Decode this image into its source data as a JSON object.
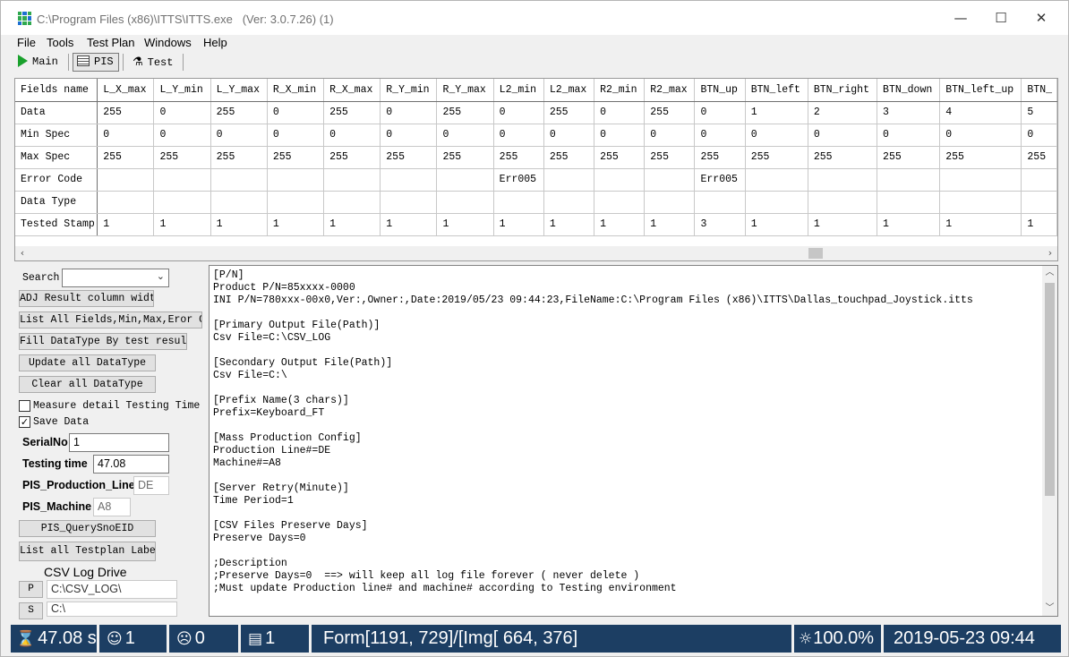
{
  "window": {
    "title": "C:\\Program Files (x86)\\ITTS\\ITTS.exe",
    "version": "(Ver: 3.0.7.26) (1)",
    "minimize": "—",
    "maximize": "☐",
    "close": "✕"
  },
  "menu": [
    "File",
    "Tools",
    "Test Plan",
    "Windows",
    "Help"
  ],
  "toolbar": {
    "main": "Main",
    "pis": "PIS",
    "test": "Test"
  },
  "grid": {
    "columns": [
      "Fields name",
      "L_X_max",
      "L_Y_min",
      "L_Y_max",
      "R_X_min",
      "R_X_max",
      "R_Y_min",
      "R_Y_max",
      "L2_min",
      "L2_max",
      "R2_min",
      "R2_max",
      "BTN_up",
      "BTN_left",
      "BTN_right",
      "BTN_down",
      "BTN_left_up",
      "BTN_"
    ],
    "rows": [
      [
        "Data",
        "255",
        "0",
        "255",
        "0",
        "255",
        "0",
        "255",
        "0",
        "255",
        "0",
        "255",
        "0",
        "1",
        "2",
        "3",
        "4",
        "5"
      ],
      [
        "Min Spec",
        "0",
        "0",
        "0",
        "0",
        "0",
        "0",
        "0",
        "0",
        "0",
        "0",
        "0",
        "0",
        "0",
        "0",
        "0",
        "0",
        "0"
      ],
      [
        "Max Spec",
        "255",
        "255",
        "255",
        "255",
        "255",
        "255",
        "255",
        "255",
        "255",
        "255",
        "255",
        "255",
        "255",
        "255",
        "255",
        "255",
        "255"
      ],
      [
        "Error Code",
        "",
        "",
        "",
        "",
        "",
        "",
        "",
        "Err005",
        "",
        "",
        "",
        "Err005",
        "",
        "",
        "",
        "",
        ""
      ],
      [
        "Data Type",
        "",
        "",
        "",
        "",
        "",
        "",
        "",
        "",
        "",
        "",
        "",
        "",
        "",
        "",
        "",
        "",
        ""
      ],
      [
        "Tested Stamp",
        "1",
        "1",
        "1",
        "1",
        "1",
        "1",
        "1",
        "1",
        "1",
        "1",
        "1",
        "3",
        "1",
        "1",
        "1",
        "1",
        "1"
      ]
    ]
  },
  "left": {
    "search_label": "Search",
    "search_value": "",
    "btn_adj": "ADJ Result column width",
    "btn_list_fields": "List All Fields,Min,Max,Eror Code",
    "btn_fill_datatype": "Fill DataType By test result",
    "btn_update_datatype": "Update all DataType",
    "btn_clear_datatype": "Clear all DataType",
    "chk_measure_label": "Measure detail Testing Time",
    "chk_measure": "",
    "chk_save_label": "Save Data",
    "chk_save": "✓",
    "serial_label": "SerialNo",
    "serial_value": "1",
    "testing_time_label": "Testing time",
    "testing_time_value": "47.08",
    "prod_line_label": "PIS_Production_Line",
    "prod_line_value": "DE",
    "machine_label": "PIS_Machine",
    "machine_value": "A8",
    "btn_query": "PIS_QuerySnoEID",
    "btn_list_testplan": "List all Testplan Label",
    "csv_title": "CSV Log Drive",
    "drive_p_btn": "P",
    "drive_p_value": "C:\\CSV_LOG\\",
    "drive_s_btn": "S",
    "drive_s_value": "C:\\"
  },
  "textpane": {
    "content": "[P/N]\nProduct P/N=85xxxx-0000\nINI P/N=780xxx-00x0,Ver:,Owner:,Date:2019/05/23 09:44:23,FileName:C:\\Program Files (x86)\\ITTS\\Dallas_touchpad_Joystick.itts\n\n[Primary Output File(Path)]\nCsv File=C:\\CSV_LOG\n\n[Secondary Output File(Path)]\nCsv File=C:\\\n\n[Prefix Name(3 chars)]\nPrefix=Keyboard_FT\n\n[Mass Production Config]\nProduction Line#=DE\nMachine#=A8\n\n[Server Retry(Minute)]\nTime Period=1\n\n[CSV Files Preserve Days]\nPreserve Days=0\n\n;Description\n;Preserve Days=0  ==> will keep all log file forever ( never delete )\n;Must update Production line# and machine# according to Testing environment"
  },
  "status": {
    "time": "47.08 s",
    "pass_count": "1",
    "fail_count": "0",
    "doc_count": "1",
    "form_info": "Form[1191, 729]/[Img[ 664, 376]",
    "zoom": "100.0%",
    "datetime": "2019-05-23  09:44"
  },
  "colors": {
    "statusbar_bg": "#1c3e63",
    "play_icon": "#1aa12d"
  }
}
